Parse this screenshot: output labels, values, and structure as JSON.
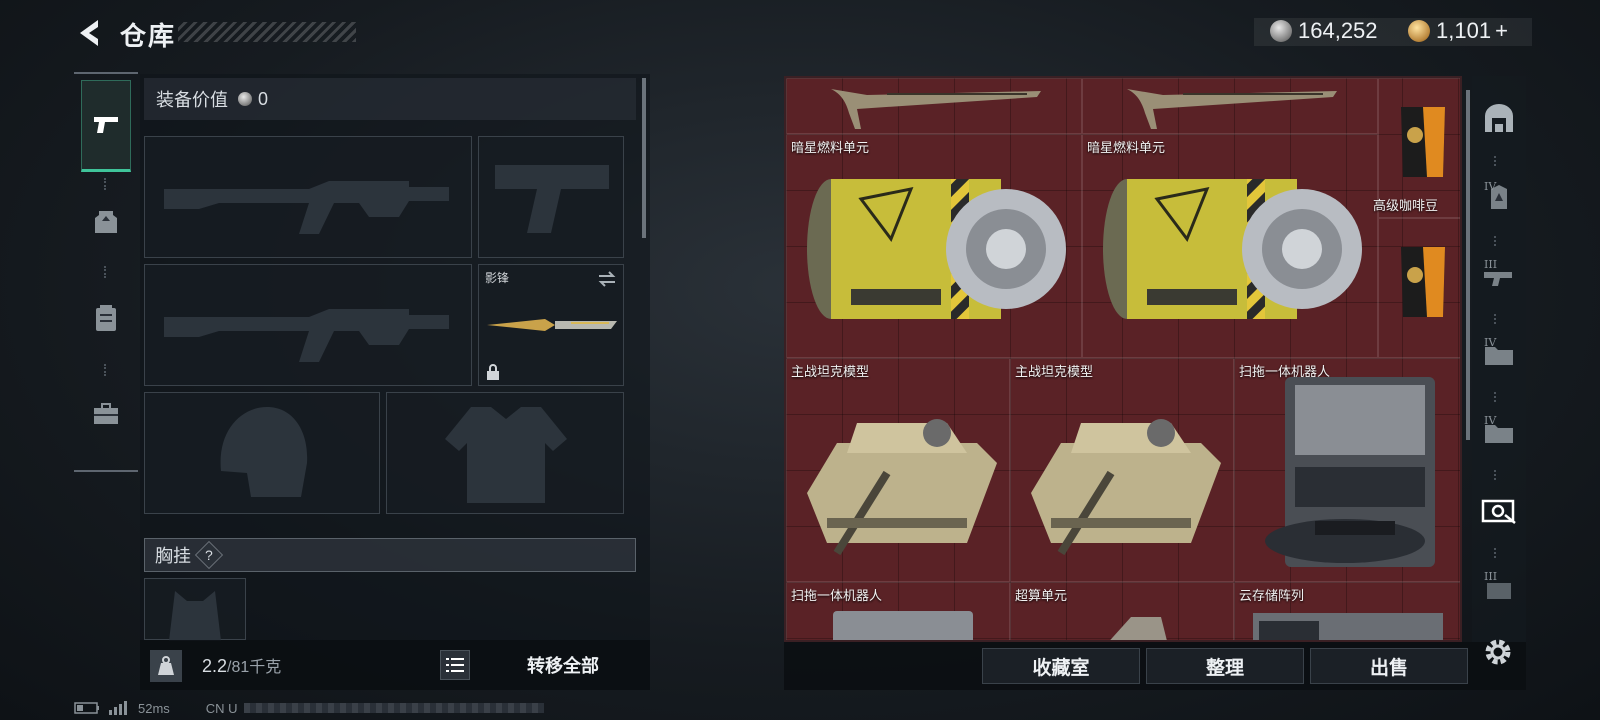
{
  "header": {
    "title": "仓库",
    "currency_silver": "164,252",
    "currency_gold": "1,101",
    "gold_add": "+"
  },
  "equipment": {
    "value_label": "装备价值",
    "value": "0",
    "melee_name": "影锋",
    "chest_label": "胸挂",
    "chest_help": "?",
    "weight_current": "2.2",
    "weight_max": "/81千克",
    "transfer_all": "转移全部"
  },
  "stash": {
    "items": [
      {
        "label": ""
      },
      {
        "label": ""
      },
      {
        "label": "暗星燃料单元"
      },
      {
        "label": "暗星燃料单元"
      },
      {
        "label": "高级咖啡豆"
      },
      {
        "label": ""
      },
      {
        "label": "主战坦克模型"
      },
      {
        "label": "主战坦克模型"
      },
      {
        "label": "扫拖一体机器人"
      },
      {
        "label": "扫拖一体机器人"
      },
      {
        "label": "超算单元"
      },
      {
        "label": "云存储阵列"
      }
    ]
  },
  "actions": {
    "collection": "收藏室",
    "organize": "整理",
    "sell": "出售"
  },
  "rail": [
    "IV",
    "III",
    "IV",
    "IV",
    "III"
  ],
  "status": {
    "ping": "52ms",
    "region": "CN U"
  }
}
